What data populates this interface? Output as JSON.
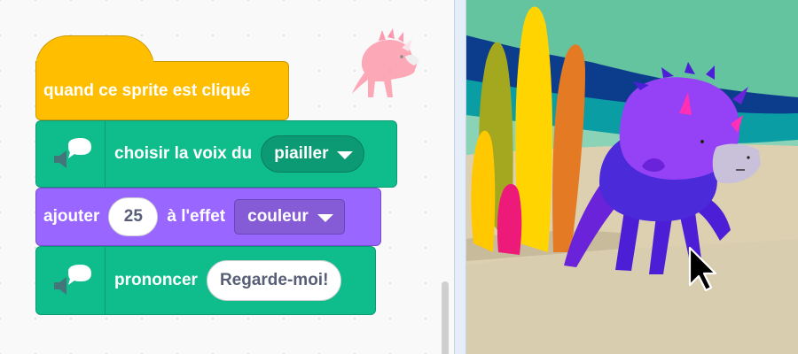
{
  "code_area": {
    "blocks": {
      "hat": {
        "label": "quand ce sprite est cliqué",
        "color": "#ffbf00"
      },
      "set_voice": {
        "label": "choisir la voix du",
        "dropdown_value": "piailler",
        "color": "#0fbd8c",
        "icon": "text2speech-speaker-icon"
      },
      "change_effect": {
        "label_before": "ajouter",
        "number_value": "25",
        "label_after": "à l'effet",
        "dropdown_value": "couleur",
        "color": "#9966ff"
      },
      "speak": {
        "label": "prononcer",
        "text_value": "Regarde-moi!",
        "color": "#0fbd8c",
        "icon": "text2speech-speaker-icon"
      }
    },
    "sprite_thumbnail": "pink-dinosaur-sprite"
  },
  "stage": {
    "sprite": "purple-dinosaur",
    "backdrop": "colorful-plants-beach",
    "cursor": "mouse-pointer-icon"
  }
}
